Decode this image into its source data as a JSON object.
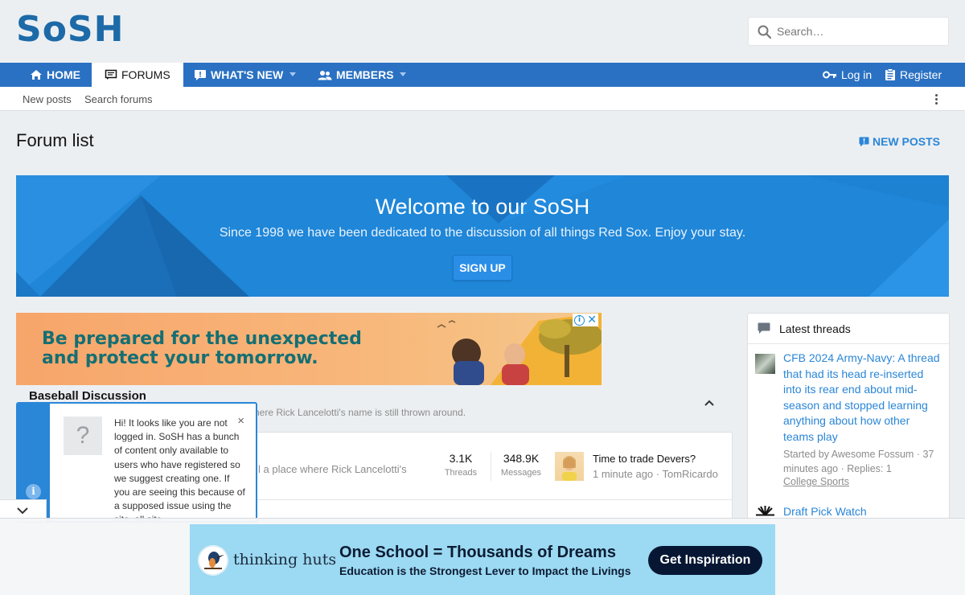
{
  "header": {
    "logo_text": "SoSH",
    "search_placeholder": "Search…"
  },
  "nav": {
    "tabs": [
      {
        "label": "HOME",
        "icon": "home-icon"
      },
      {
        "label": "FORUMS",
        "icon": "forum-icon",
        "active": true
      },
      {
        "label": "WHAT'S NEW",
        "icon": "whats-new-icon"
      },
      {
        "label": "MEMBERS",
        "icon": "members-icon"
      }
    ],
    "login_label": "Log in",
    "register_label": "Register"
  },
  "subnav": {
    "new_posts": "New posts",
    "search_forums": "Search forums"
  },
  "page": {
    "title": "Forum list",
    "new_posts_button": "NEW POSTS"
  },
  "welcome": {
    "title": "Welcome to our SoSH",
    "subtitle": "Since 1998 we have been dedicated to the discussion of all things Red Sox. Enjoy your stay.",
    "signup_label": "SIGN UP"
  },
  "top_ad": {
    "line1": "Be prepared for the unexpected",
    "line2": "and protect your tomorrow."
  },
  "category": {
    "title": "Baseball Discussion",
    "description_visible": "here Rick Lancelotti's name is still thrown around.",
    "forum": {
      "description_visible": "l a place where Rick Lancelotti's",
      "threads_value": "3.1K",
      "threads_label": "Threads",
      "messages_value": "348.9K",
      "messages_label": "Messages",
      "last_post_title": "Time to trade Devers?",
      "last_post_meta": "1 minute ago · TomRicardo"
    }
  },
  "sidebar": {
    "header": "Latest threads",
    "threads": [
      {
        "title": "CFB 2024 Army-Navy: A thread that had its head re-inserted into its rear end about mid-season and stopped learning anything about how other teams play",
        "meta": "Started by Awesome Fossum · 37 minutes ago · Replies: 1",
        "forum": "College Sports"
      },
      {
        "title": "Draft Pick Watch"
      }
    ]
  },
  "popup": {
    "icon_text": "?",
    "info_text": "i",
    "close": "×",
    "text": "Hi! It looks like you are not logged in. SoSH has a bunch of content only available to users who have registered so we suggest creating one. If you are seeing this because of a supposed issue using the site, all site"
  },
  "bottom_ad": {
    "brand": "thinking huts",
    "headline": "One School = Thousands of Dreams",
    "subline": "Education is the Strongest Lever to Impact the Livings",
    "cta": "Get Inspiration"
  },
  "colors": {
    "nav_blue": "#2a71c3",
    "link_blue": "#2a86d7",
    "banner_blue": "#1f86d8",
    "logo_blue": "#1c6aa8"
  }
}
